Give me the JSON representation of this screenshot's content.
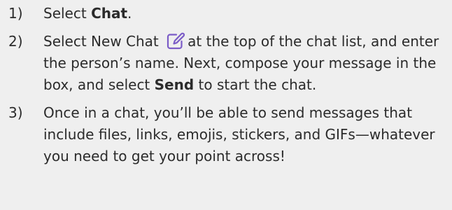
{
  "steps": [
    {
      "number": "1)",
      "text_before": "Select ",
      "bold": "Chat",
      "text_after": "."
    },
    {
      "number": "2)",
      "text_before": "Select New Chat ",
      "icon": "new-chat-icon",
      "text_middle": "at the top of the chat list, and enter the person’s name. Next, compose your message in the box, and select ",
      "bold": "Send",
      "text_after": " to start the chat."
    },
    {
      "number": "3)",
      "text": "Once in a chat, you’ll be able to send messages that include files, links, emojis, stickers, and GIFs—whatever you need to get your point across!"
    }
  ],
  "colors": {
    "background": "#efefef",
    "text": "#2b2b2b",
    "icon": "#7b5cc7"
  }
}
